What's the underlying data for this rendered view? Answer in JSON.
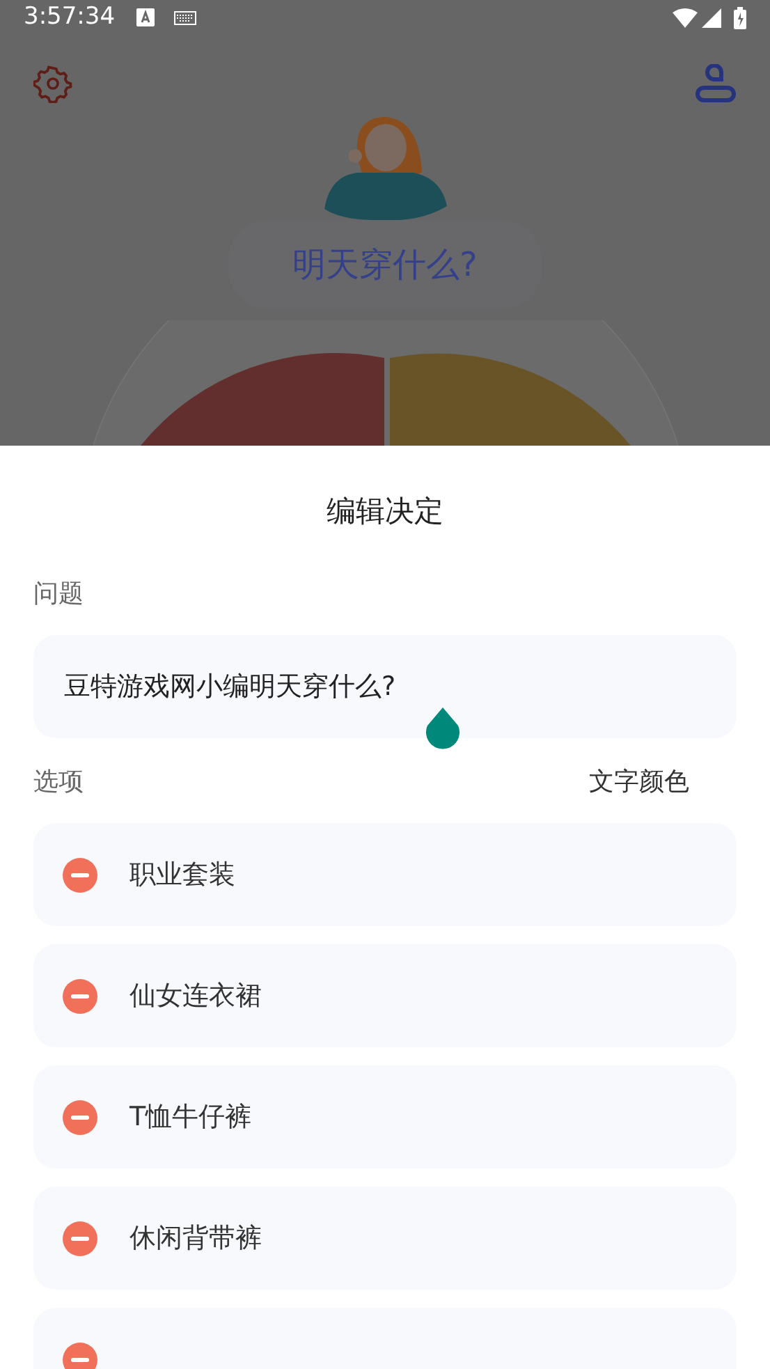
{
  "status_bar": {
    "time": "3:57:34"
  },
  "background": {
    "question": "明天穿什么?"
  },
  "sheet": {
    "title": "编辑决定",
    "question_label": "问题",
    "question_value": "豆特游戏网小编明天穿什么?",
    "options_label": "选项",
    "text_color_label": "文字颜色",
    "options": [
      {
        "label": "职业套装"
      },
      {
        "label": "仙女连衣裙"
      },
      {
        "label": "T恤牛仔裤"
      },
      {
        "label": "休闲背带裤"
      }
    ]
  }
}
